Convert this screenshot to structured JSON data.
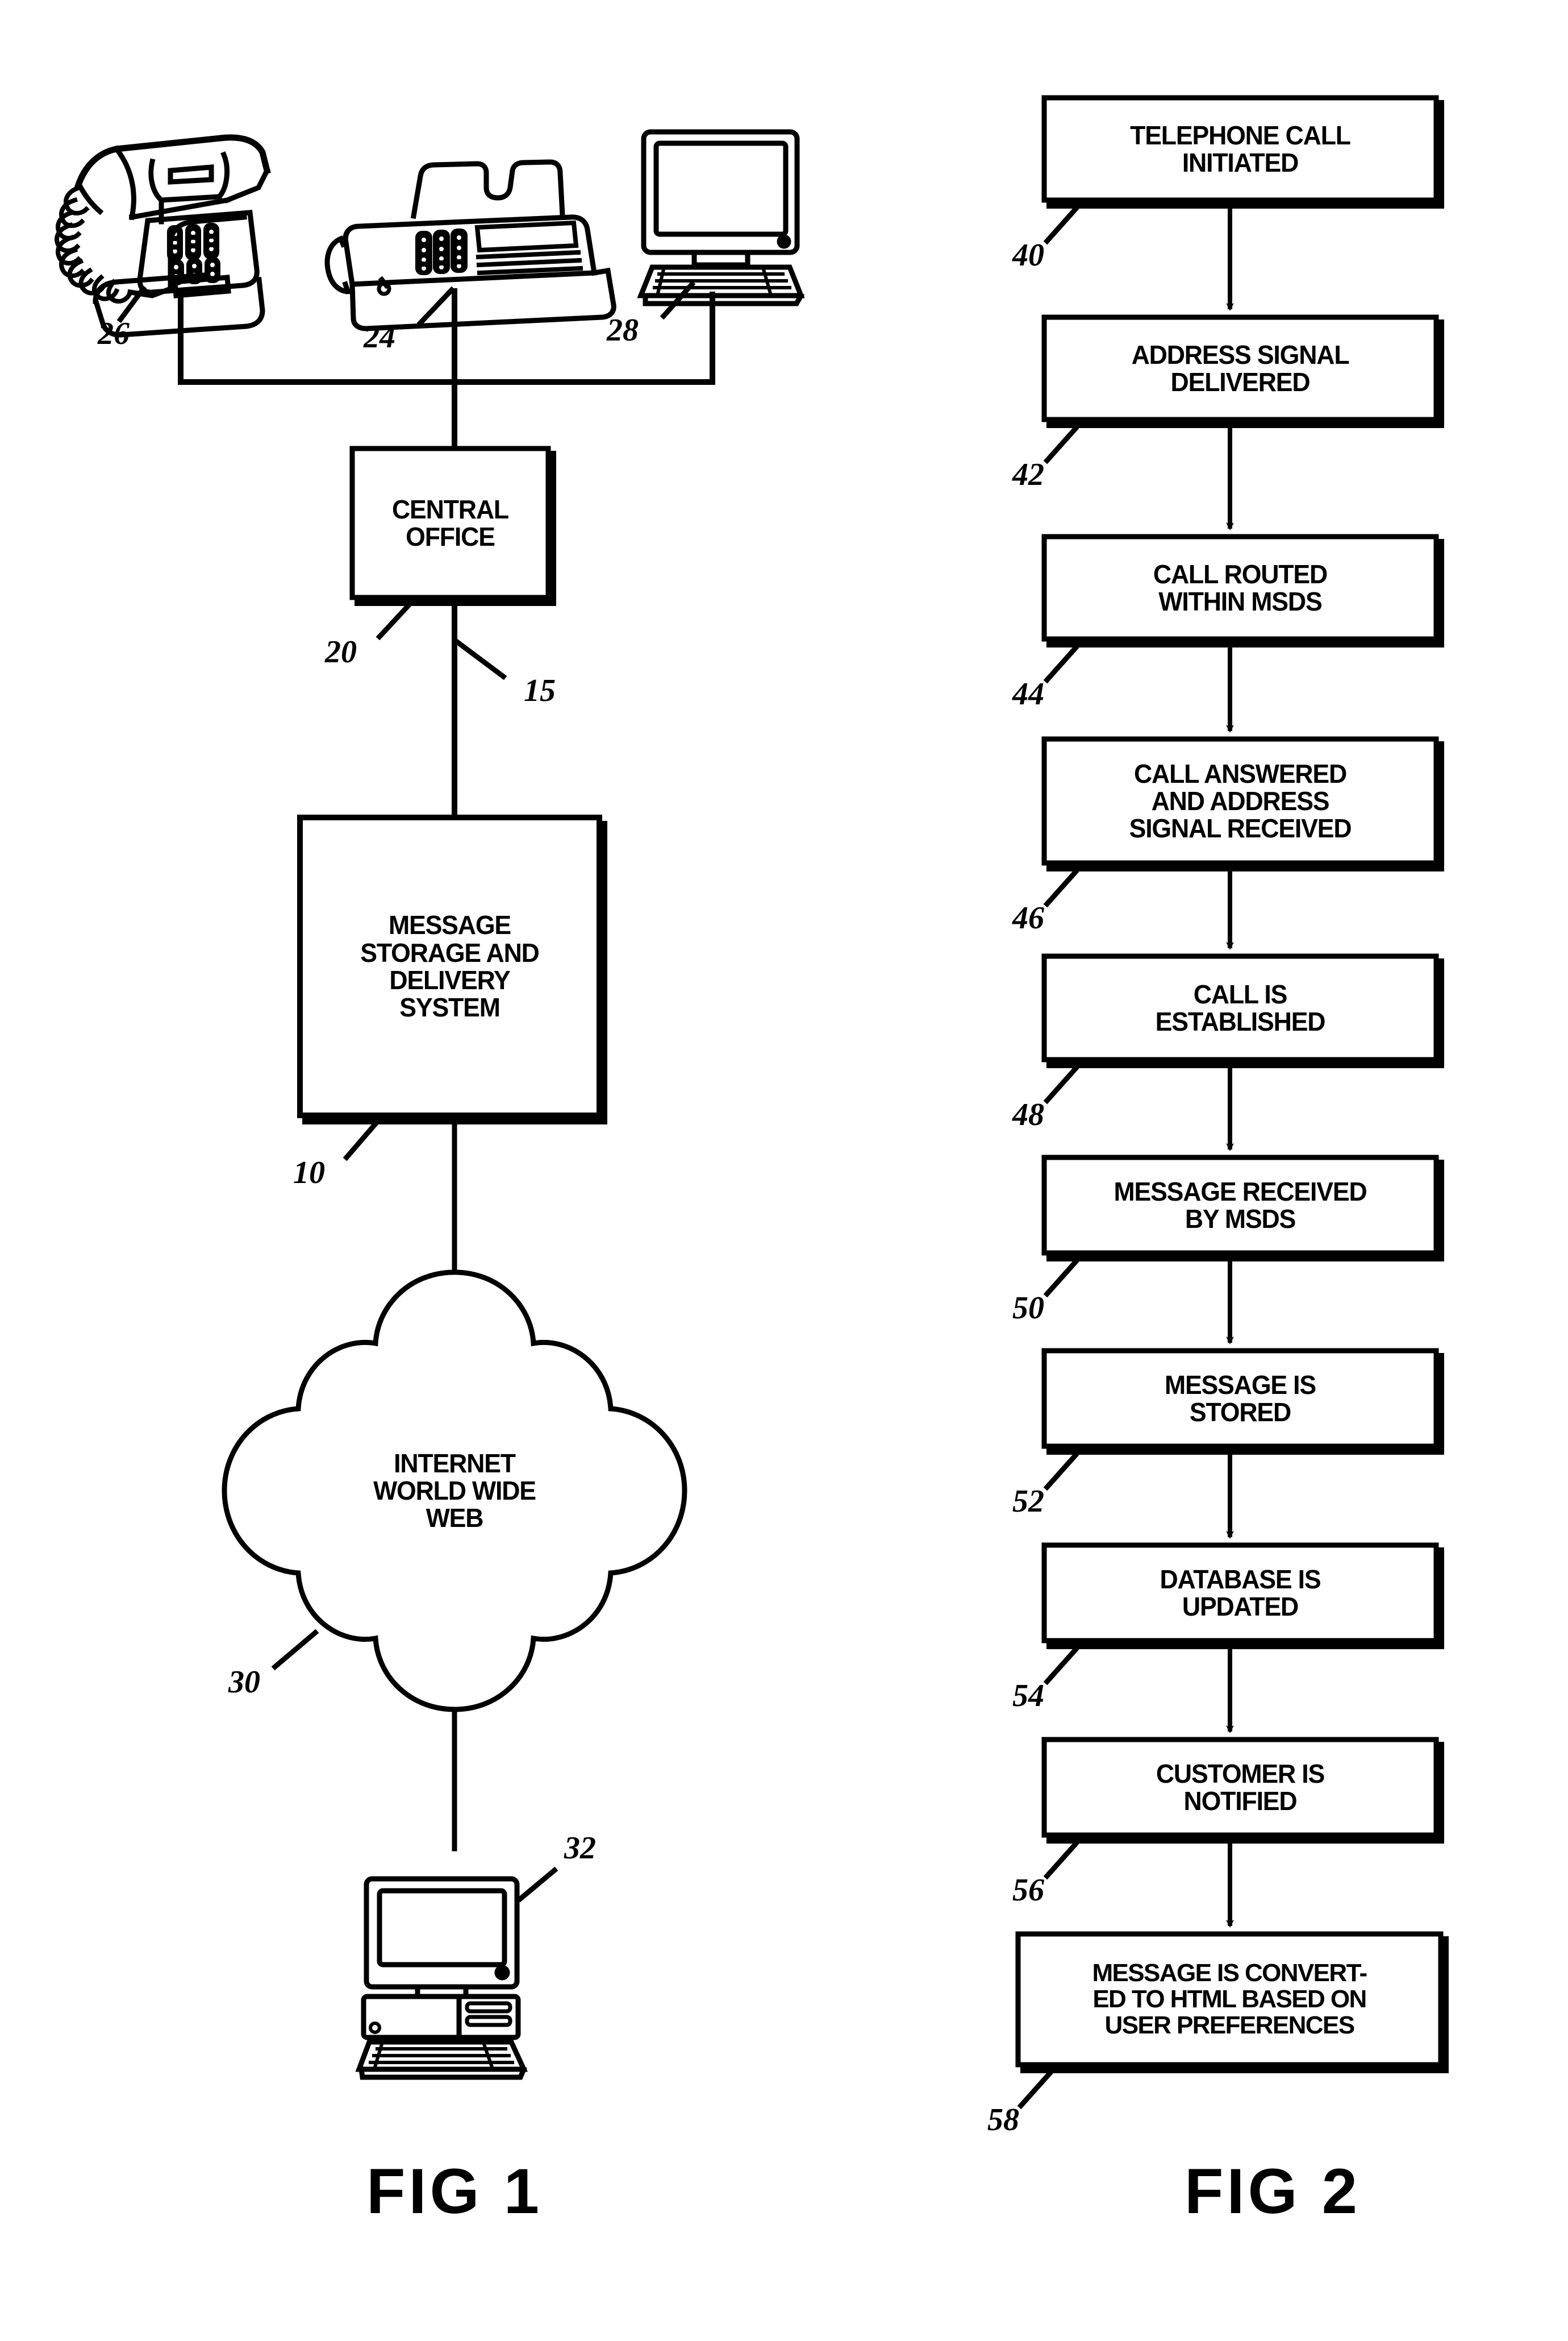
{
  "page": {
    "background": "#ffffff",
    "ink": "#000000"
  },
  "figure1": {
    "caption": "FIG 1",
    "nodes": {
      "telephone": {
        "ref": "26",
        "icon": "desk-telephone-icon"
      },
      "fax": {
        "ref": "24",
        "icon": "fax-machine-icon"
      },
      "computer_top": {
        "ref": "28",
        "icon": "desktop-computer-icon"
      },
      "central_office": {
        "ref": "20",
        "label": "CENTRAL\nOFFICE"
      },
      "link_15": {
        "ref": "15"
      },
      "msds": {
        "ref": "10",
        "label": "MESSAGE\nSTORAGE AND\nDELIVERY\nSYSTEM"
      },
      "internet_cloud": {
        "ref": "30",
        "label": "INTERNET\nWORLD WIDE\nWEB"
      },
      "computer_bottom": {
        "ref": "32",
        "icon": "desktop-computer-icon"
      }
    }
  },
  "figure2": {
    "caption": "FIG 2",
    "steps": [
      {
        "ref": "40",
        "label": "TELEPHONE CALL\nINITIATED"
      },
      {
        "ref": "42",
        "label": "ADDRESS SIGNAL\nDELIVERED"
      },
      {
        "ref": "44",
        "label": "CALL ROUTED\nWITHIN MSDS"
      },
      {
        "ref": "46",
        "label": "CALL ANSWERED\nAND ADDRESS\nSIGNAL RECEIVED"
      },
      {
        "ref": "48",
        "label": "CALL IS\nESTABLISHED"
      },
      {
        "ref": "50",
        "label": "MESSAGE RECEIVED\nBY MSDS"
      },
      {
        "ref": "52",
        "label": "MESSAGE IS\nSTORED"
      },
      {
        "ref": "54",
        "label": "DATABASE IS\nUPDATED"
      },
      {
        "ref": "56",
        "label": "CUSTOMER IS\nNOTIFIED"
      },
      {
        "ref": "58",
        "label": "MESSAGE IS CONVERT-\nED TO HTML BASED ON\nUSER PREFERENCES"
      }
    ]
  }
}
